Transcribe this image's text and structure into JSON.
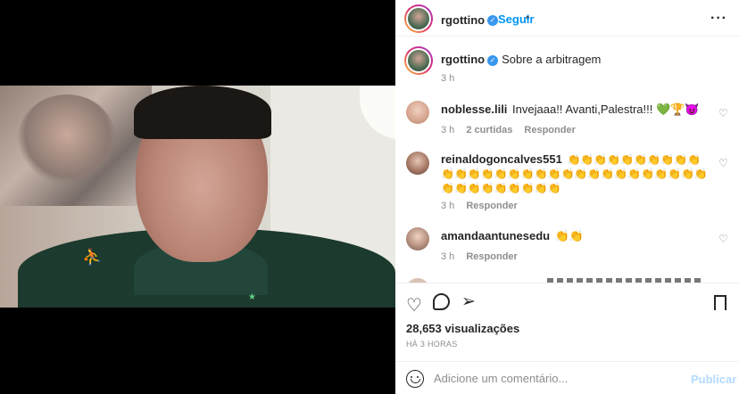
{
  "post": {
    "username": "rgottino",
    "follow_label": "Seguir",
    "separator": "•",
    "more_label": "···",
    "caption": "Sobre a arbitragem",
    "caption_time": "3 h"
  },
  "comments": [
    {
      "username": "noblesse.lili",
      "text": "Invejaaa!! Avanti,Palestra!!! 💚🏆😈",
      "time": "3 h",
      "likes": "2 curtidas",
      "reply": "Responder"
    },
    {
      "username": "reinaldogoncalves551",
      "text": "👏👏👏👏👏👏👏👏👏👏👏👏👏👏👏👏👏👏👏👏👏👏👏👏👏👏👏👏👏👏👏👏👏👏👏👏👏👏👏",
      "time": "3 h",
      "reply": "Responder"
    },
    {
      "username": "amandaantunesedu",
      "text": "👏👏",
      "time": "3 h",
      "reply": "Responder"
    }
  ],
  "actions": {
    "views": "28,653 visualizações",
    "time_ago": "HÁ 3 HORAS"
  },
  "add_comment": {
    "placeholder": "Adicione um comentário...",
    "publish_label": "Publicar"
  },
  "colors": {
    "link_blue": "#0095f6",
    "verified": "#3897f0",
    "muted": "#8e8e8e",
    "publish_disabled": "#b3dbff"
  }
}
